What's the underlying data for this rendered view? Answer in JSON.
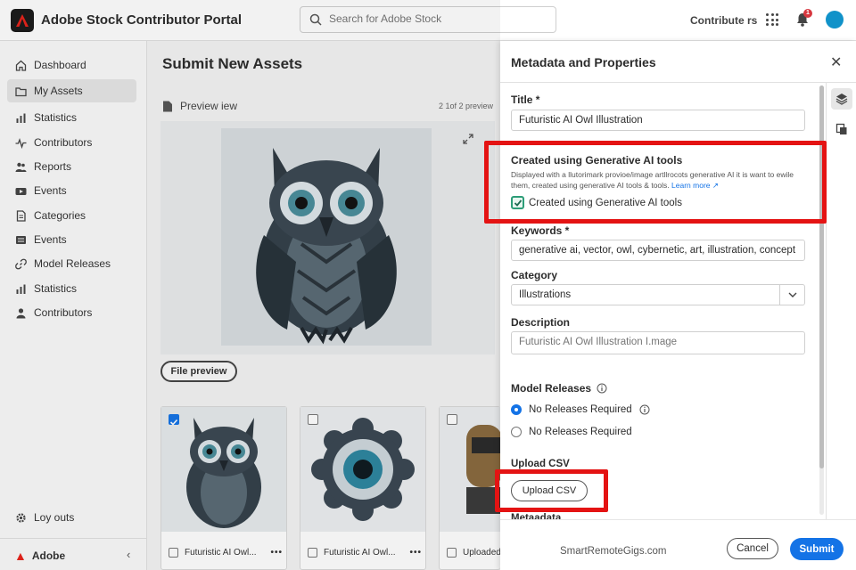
{
  "app": {
    "title": "Adobe Stock Contributor Portal"
  },
  "header": {
    "search_placeholder": "Search for Adobe Stock",
    "contribute_link": "Contribute rs",
    "notification_count": "1"
  },
  "sidebar": {
    "items": [
      {
        "label": "Dashboard",
        "icon": "home-icon"
      },
      {
        "label": "My Assets",
        "icon": "folder-icon",
        "active": true
      },
      {
        "label": "Statistics",
        "icon": "bar-chart-icon"
      },
      {
        "label": "Contributors",
        "icon": "activity-icon"
      },
      {
        "label": "Reports",
        "icon": "people-icon"
      },
      {
        "label": "Events",
        "icon": "video-icon"
      },
      {
        "label": "Categories",
        "icon": "document-icon"
      },
      {
        "label": "Events",
        "icon": "list-icon"
      },
      {
        "label": "Model Releases",
        "icon": "link-icon"
      },
      {
        "label": "Statistics",
        "icon": "bar-chart-icon"
      },
      {
        "label": "Contributors",
        "icon": "person-icon"
      }
    ],
    "bottom_item": "Loy outs",
    "brand": "Adobe"
  },
  "main": {
    "title": "Submit New Assets",
    "preview_label": "Preview iew",
    "preview_count": "2 1of 2 preview",
    "file_preview_button": "File preview",
    "thumbnails": [
      {
        "name": "Futuristic AI Owl...",
        "checked": true
      },
      {
        "name": "Futuristic AI Owl...",
        "checked": false
      },
      {
        "name": "Uploaded",
        "checked": false
      }
    ]
  },
  "panel": {
    "title": "Metadata and Properties",
    "title_label": "Title *",
    "title_value": "Futuristic AI Owl Illustration",
    "gen_ai_heading": "Created using Generative AI tools",
    "gen_ai_description": "Displayed with a llutorimark provioe/image artllrocots generative AI it is want to ewile them, created using generative AI tools & tools.",
    "learn_more": "Learn more",
    "gen_ai_checkbox_label": "Created using Generative AI tools",
    "gen_ai_checked": true,
    "keywords_label": "Keywords *",
    "keywords_value": "generative ai, vector, owl, cybernetic, art, illustration, concept",
    "category_label": "Category",
    "category_value": "Illustrations",
    "description_label": "Description",
    "description_placeholder": "Futuristic AI Owl Illustration I.mage",
    "model_releases_label": "Model Releases",
    "radio_options": [
      {
        "label": "No Releases Required",
        "selected": true
      },
      {
        "label": "No Releases Required",
        "selected": false
      }
    ],
    "upload_csv_label": "Upload CSV",
    "upload_csv_button": "Upload CSV",
    "metadata_label": "Metaadata",
    "cancel_button": "Cancel",
    "submit_button": "Submit"
  },
  "watermark": "SmartRemoteGigs.com",
  "colors": {
    "accent": "#1473e6",
    "highlight": "#e41313",
    "check_green": "#2d9d78",
    "adobe_red": "#e8231a"
  }
}
